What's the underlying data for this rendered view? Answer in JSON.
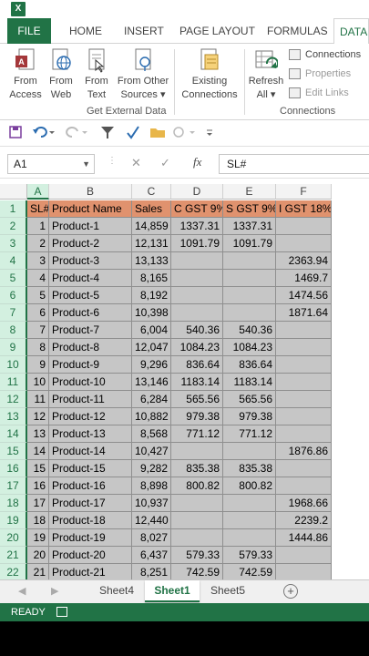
{
  "app": {
    "logo": "X"
  },
  "ribbon_tabs": [
    {
      "label": "FILE"
    },
    {
      "label": "HOME"
    },
    {
      "label": "INSERT"
    },
    {
      "label": "PAGE LAYOUT"
    },
    {
      "label": "FORMULAS"
    },
    {
      "label": "DATA"
    }
  ],
  "get_external": {
    "buttons": [
      {
        "line1": "From",
        "line2": "Access",
        "icon": "access-icon"
      },
      {
        "line1": "From",
        "line2": "Web",
        "icon": "web-icon"
      },
      {
        "line1": "From",
        "line2": "Text",
        "icon": "text-file-icon"
      },
      {
        "line1": "From Other",
        "line2": "Sources ▾",
        "icon": "other-sources-icon"
      },
      {
        "line1": "Existing",
        "line2": "Connections",
        "icon": "existing-connections-icon"
      }
    ],
    "group_label": "Get External Data"
  },
  "connections": {
    "refresh": {
      "line1": "Refresh",
      "line2": "All ▾",
      "icon": "refresh-icon"
    },
    "items": [
      {
        "label": "Connections",
        "disabled": false
      },
      {
        "label": "Properties",
        "disabled": true
      },
      {
        "label": "Edit Links",
        "disabled": true
      }
    ],
    "group_label": "Connections"
  },
  "formula_bar": {
    "name_box": "A1",
    "cancel": "✕",
    "enter": "✓",
    "fx": "fx",
    "content": "SL#"
  },
  "columns": [
    "A",
    "B",
    "C",
    "D",
    "E",
    "F"
  ],
  "header_row": [
    "SL#",
    "Product Name",
    "Sales",
    "C GST 9%",
    "S GST 9%",
    "I GST 18%"
  ],
  "rows": [
    {
      "n": "2",
      "a": "1",
      "b": "Product-1",
      "c": "14,859",
      "d": "1337.31",
      "e": "1337.31",
      "f": ""
    },
    {
      "n": "3",
      "a": "2",
      "b": "Product-2",
      "c": "12,131",
      "d": "1091.79",
      "e": "1091.79",
      "f": ""
    },
    {
      "n": "4",
      "a": "3",
      "b": "Product-3",
      "c": "13,133",
      "d": "",
      "e": "",
      "f": "2363.94"
    },
    {
      "n": "5",
      "a": "4",
      "b": "Product-4",
      "c": "8,165",
      "d": "",
      "e": "",
      "f": "1469.7"
    },
    {
      "n": "6",
      "a": "5",
      "b": "Product-5",
      "c": "8,192",
      "d": "",
      "e": "",
      "f": "1474.56"
    },
    {
      "n": "7",
      "a": "6",
      "b": "Product-6",
      "c": "10,398",
      "d": "",
      "e": "",
      "f": "1871.64"
    },
    {
      "n": "8",
      "a": "7",
      "b": "Product-7",
      "c": "6,004",
      "d": "540.36",
      "e": "540.36",
      "f": ""
    },
    {
      "n": "9",
      "a": "8",
      "b": "Product-8",
      "c": "12,047",
      "d": "1084.23",
      "e": "1084.23",
      "f": ""
    },
    {
      "n": "10",
      "a": "9",
      "b": "Product-9",
      "c": "9,296",
      "d": "836.64",
      "e": "836.64",
      "f": ""
    },
    {
      "n": "11",
      "a": "10",
      "b": "Product-10",
      "c": "13,146",
      "d": "1183.14",
      "e": "1183.14",
      "f": ""
    },
    {
      "n": "12",
      "a": "11",
      "b": "Product-11",
      "c": "6,284",
      "d": "565.56",
      "e": "565.56",
      "f": ""
    },
    {
      "n": "13",
      "a": "12",
      "b": "Product-12",
      "c": "10,882",
      "d": "979.38",
      "e": "979.38",
      "f": ""
    },
    {
      "n": "14",
      "a": "13",
      "b": "Product-13",
      "c": "8,568",
      "d": "771.12",
      "e": "771.12",
      "f": ""
    },
    {
      "n": "15",
      "a": "14",
      "b": "Product-14",
      "c": "10,427",
      "d": "",
      "e": "",
      "f": "1876.86"
    },
    {
      "n": "16",
      "a": "15",
      "b": "Product-15",
      "c": "9,282",
      "d": "835.38",
      "e": "835.38",
      "f": ""
    },
    {
      "n": "17",
      "a": "16",
      "b": "Product-16",
      "c": "8,898",
      "d": "800.82",
      "e": "800.82",
      "f": ""
    },
    {
      "n": "18",
      "a": "17",
      "b": "Product-17",
      "c": "10,937",
      "d": "",
      "e": "",
      "f": "1968.66"
    },
    {
      "n": "19",
      "a": "18",
      "b": "Product-18",
      "c": "12,440",
      "d": "",
      "e": "",
      "f": "2239.2"
    },
    {
      "n": "20",
      "a": "19",
      "b": "Product-19",
      "c": "8,027",
      "d": "",
      "e": "",
      "f": "1444.86"
    },
    {
      "n": "21",
      "a": "20",
      "b": "Product-20",
      "c": "6,437",
      "d": "579.33",
      "e": "579.33",
      "f": ""
    },
    {
      "n": "22",
      "a": "21",
      "b": "Product-21",
      "c": "8,251",
      "d": "742.59",
      "e": "742.59",
      "f": ""
    }
  ],
  "sheet_tabs": [
    {
      "label": "Sheet4",
      "active": false
    },
    {
      "label": "Sheet1",
      "active": true
    },
    {
      "label": "Sheet5",
      "active": false
    }
  ],
  "add_sheet": "+",
  "status": {
    "text": "READY"
  },
  "colors": {
    "accent": "#217346",
    "header_fill": "#e0926e",
    "cell_fill": "#c6c6c6"
  }
}
